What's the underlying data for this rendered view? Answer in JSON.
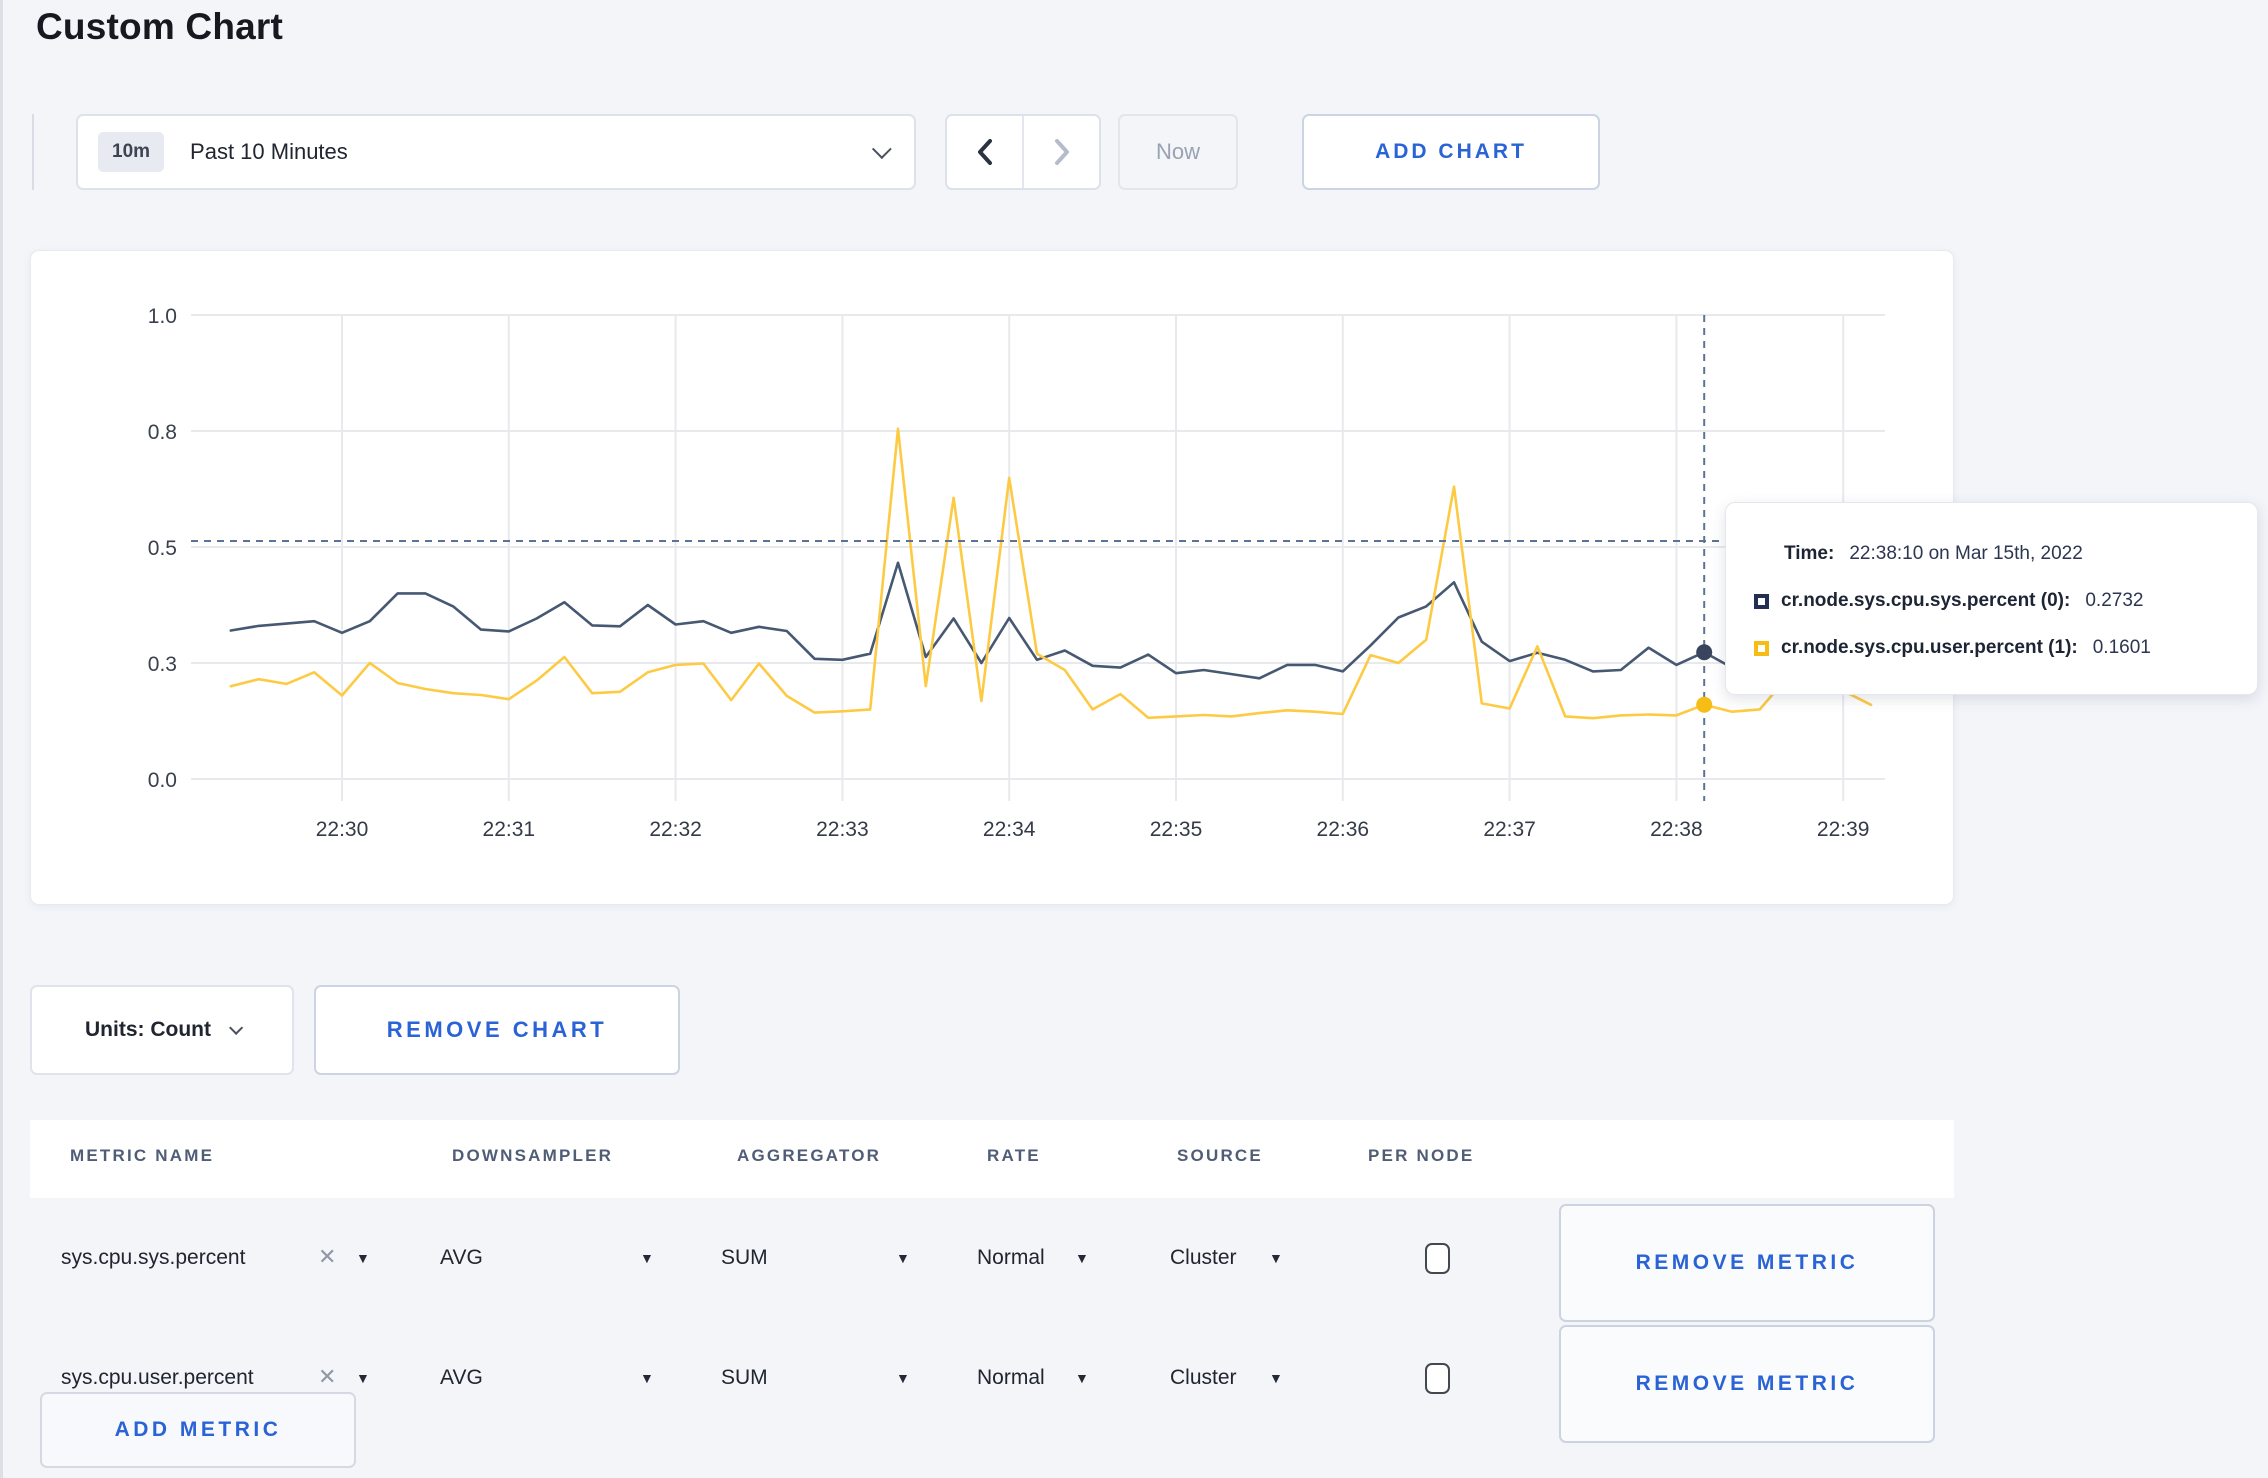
{
  "page": {
    "title": "Custom Chart",
    "background": "#f3f5f9",
    "accent_blue": "#2a63d5"
  },
  "toolbar": {
    "time_badge": "10m",
    "time_label": "Past 10 Minutes",
    "prev_icon": "chevron-left",
    "next_icon": "chevron-right",
    "now_label": "Now",
    "add_chart_label": "ADD CHART"
  },
  "chart_data": {
    "type": "line",
    "title": "",
    "xlabel": "",
    "ylabel": "",
    "ylim": [
      0,
      1
    ],
    "grid": true,
    "y_tick_values": [
      0,
      0.25,
      0.5,
      0.75,
      1.0
    ],
    "y_tick_labels": [
      "0.0",
      "0.3",
      "0.5",
      "0.8",
      "1.0"
    ],
    "x_tick_labels": [
      "22:30",
      "22:31",
      "22:32",
      "22:33",
      "22:34",
      "22:35",
      "22:36",
      "22:37",
      "22:38",
      "22:39"
    ],
    "start_time": "22:29:20",
    "interval_seconds": 10,
    "series": [
      {
        "name": "cr.node.sys.cpu.sys.percent (0)",
        "color": "#475872",
        "values": [
          0.32,
          0.33,
          0.335,
          0.34,
          0.315,
          0.34,
          0.4,
          0.4,
          0.372,
          0.322,
          0.318,
          0.346,
          0.381,
          0.331,
          0.329,
          0.375,
          0.333,
          0.34,
          0.315,
          0.328,
          0.319,
          0.259,
          0.257,
          0.27,
          0.466,
          0.263,
          0.346,
          0.25,
          0.347,
          0.257,
          0.277,
          0.244,
          0.24,
          0.268,
          0.228,
          0.235,
          0.226,
          0.217,
          0.246,
          0.246,
          0.232,
          0.288,
          0.348,
          0.372,
          0.424,
          0.296,
          0.254,
          0.272,
          0.257,
          0.232,
          0.235,
          0.283,
          0.246,
          0.2732,
          0.24,
          0.258,
          0.28,
          0.3,
          0.295,
          0.3
        ]
      },
      {
        "name": "cr.node.sys.cpu.user.percent (1)",
        "color": "#fdca44",
        "values": [
          0.2,
          0.215,
          0.205,
          0.23,
          0.18,
          0.25,
          0.207,
          0.194,
          0.185,
          0.181,
          0.172,
          0.212,
          0.263,
          0.185,
          0.188,
          0.23,
          0.246,
          0.249,
          0.17,
          0.249,
          0.179,
          0.143,
          0.146,
          0.15,
          0.755,
          0.2,
          0.606,
          0.168,
          0.649,
          0.27,
          0.235,
          0.15,
          0.183,
          0.132,
          0.135,
          0.138,
          0.135,
          0.142,
          0.148,
          0.145,
          0.14,
          0.267,
          0.25,
          0.3,
          0.63,
          0.163,
          0.152,
          0.286,
          0.135,
          0.131,
          0.137,
          0.139,
          0.137,
          0.1601,
          0.145,
          0.15,
          0.22,
          0.27,
          0.19,
          0.16
        ]
      }
    ],
    "crosshair": {
      "time": "22:38:10",
      "index": 53,
      "y_frac": 0.513,
      "sys_value": 0.2732,
      "user_value": 0.1601
    },
    "legend_position": "tooltip"
  },
  "tooltip": {
    "time_label": "Time:",
    "time_value": "22:38:10 on Mar 15th, 2022",
    "rows": [
      {
        "label": "cr.node.sys.cpu.sys.percent (0):",
        "value": "0.2732",
        "color": "#222f52"
      },
      {
        "label": "cr.node.sys.cpu.user.percent (1):",
        "value": "0.1601",
        "color": "#f6bd16"
      }
    ]
  },
  "chart_footer": {
    "units_label": "Units: Count",
    "remove_chart_label": "REMOVE CHART"
  },
  "metrics_table": {
    "headers": [
      "METRIC NAME",
      "DOWNSAMPLER",
      "AGGREGATOR",
      "RATE",
      "SOURCE",
      "PER NODE"
    ],
    "remove_icon": "x",
    "rows": [
      {
        "metric": "sys.cpu.sys.percent",
        "downsampler": "AVG",
        "aggregator": "SUM",
        "rate": "Normal",
        "source": "Cluster",
        "per_node": false,
        "remove_label": "REMOVE METRIC"
      },
      {
        "metric": "sys.cpu.user.percent",
        "downsampler": "AVG",
        "aggregator": "SUM",
        "rate": "Normal",
        "source": "Cluster",
        "per_node": false,
        "remove_label": "REMOVE METRIC"
      }
    ],
    "add_metric_label": "ADD METRIC"
  }
}
